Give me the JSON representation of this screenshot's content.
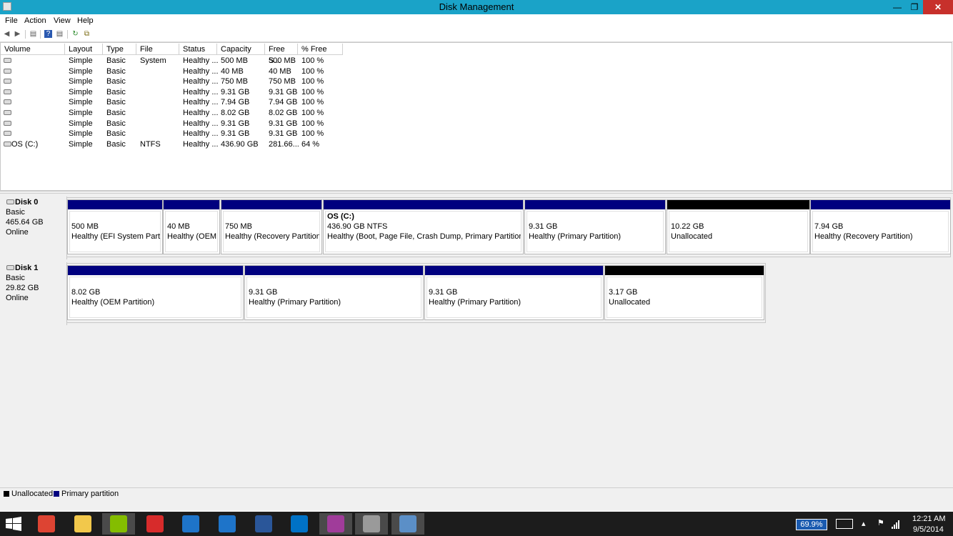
{
  "window": {
    "title": "Disk Management",
    "min_label": "—",
    "max_label": "❐",
    "close_label": "✕"
  },
  "menu": [
    "File",
    "Action",
    "View",
    "Help"
  ],
  "toolbar": {
    "back": "◀",
    "forward": "▶",
    "props": "▤",
    "help": "?",
    "list": "▤",
    "refresh": "↻",
    "rescan": "⧉"
  },
  "columns": [
    "Volume",
    "Layout",
    "Type",
    "File System",
    "Status",
    "Capacity",
    "Free S...",
    "% Free"
  ],
  "volumes": [
    {
      "volume": "",
      "layout": "Simple",
      "type": "Basic",
      "fs": "",
      "status": "Healthy ...",
      "capacity": "500 MB",
      "free": "500 MB",
      "pct": "100 %"
    },
    {
      "volume": "",
      "layout": "Simple",
      "type": "Basic",
      "fs": "",
      "status": "Healthy ...",
      "capacity": "40 MB",
      "free": "40 MB",
      "pct": "100 %"
    },
    {
      "volume": "",
      "layout": "Simple",
      "type": "Basic",
      "fs": "",
      "status": "Healthy ...",
      "capacity": "750 MB",
      "free": "750 MB",
      "pct": "100 %"
    },
    {
      "volume": "",
      "layout": "Simple",
      "type": "Basic",
      "fs": "",
      "status": "Healthy ...",
      "capacity": "9.31 GB",
      "free": "9.31 GB",
      "pct": "100 %"
    },
    {
      "volume": "",
      "layout": "Simple",
      "type": "Basic",
      "fs": "",
      "status": "Healthy ...",
      "capacity": "7.94 GB",
      "free": "7.94 GB",
      "pct": "100 %"
    },
    {
      "volume": "",
      "layout": "Simple",
      "type": "Basic",
      "fs": "",
      "status": "Healthy ...",
      "capacity": "8.02 GB",
      "free": "8.02 GB",
      "pct": "100 %"
    },
    {
      "volume": "",
      "layout": "Simple",
      "type": "Basic",
      "fs": "",
      "status": "Healthy ...",
      "capacity": "9.31 GB",
      "free": "9.31 GB",
      "pct": "100 %"
    },
    {
      "volume": "",
      "layout": "Simple",
      "type": "Basic",
      "fs": "",
      "status": "Healthy ...",
      "capacity": "9.31 GB",
      "free": "9.31 GB",
      "pct": "100 %"
    },
    {
      "volume": "OS (C:)",
      "layout": "Simple",
      "type": "Basic",
      "fs": "NTFS",
      "status": "Healthy ...",
      "capacity": "436.90 GB",
      "free": "281.66...",
      "pct": "64 %"
    }
  ],
  "disks": [
    {
      "name": "Disk 0",
      "kind": "Basic",
      "size": "465.64 GB",
      "state": "Online",
      "partitions": [
        {
          "title": "",
          "size": "500 MB",
          "status": "Healthy (EFI System Partitic",
          "type": "primary"
        },
        {
          "title": "",
          "size": "40 MB",
          "status": "Healthy (OEM F",
          "type": "primary"
        },
        {
          "title": "",
          "size": "750 MB",
          "status": "Healthy (Recovery Partition)",
          "type": "primary"
        },
        {
          "title": "OS  (C:)",
          "size": "436.90 GB NTFS",
          "status": "Healthy (Boot, Page File, Crash Dump, Primary Partition)",
          "type": "primary"
        },
        {
          "title": "",
          "size": "9.31 GB",
          "status": "Healthy (Primary Partition)",
          "type": "primary"
        },
        {
          "title": "",
          "size": "10.22 GB",
          "status": "Unallocated",
          "type": "unallocated"
        },
        {
          "title": "",
          "size": "7.94 GB",
          "status": "Healthy (Recovery Partition)",
          "type": "primary"
        }
      ]
    },
    {
      "name": "Disk 1",
      "kind": "Basic",
      "size": "29.82 GB",
      "state": "Online",
      "partitions": [
        {
          "title": "",
          "size": "8.02 GB",
          "status": "Healthy (OEM Partition)",
          "type": "primary"
        },
        {
          "title": "",
          "size": "9.31 GB",
          "status": "Healthy (Primary Partition)",
          "type": "primary"
        },
        {
          "title": "",
          "size": "9.31 GB",
          "status": "Healthy (Primary Partition)",
          "type": "primary"
        },
        {
          "title": "",
          "size": "3.17 GB",
          "status": "Unallocated",
          "type": "unallocated"
        }
      ]
    }
  ],
  "legend": {
    "unallocated": "Unallocated",
    "primary": "Primary partition"
  },
  "colors": {
    "titlebar": "#1aa3c8",
    "primary": "#00007f",
    "unallocated": "#000000",
    "close": "#c7302b",
    "taskbar": "#1c1c1c"
  },
  "taskbar": {
    "apps": [
      {
        "icon": "chrome-icon",
        "color": "#dd4433",
        "active": false
      },
      {
        "icon": "file-explorer-icon",
        "color": "#f2c84b",
        "active": false
      },
      {
        "icon": "spotify-icon",
        "color": "#84bd00",
        "active": true
      },
      {
        "icon": "kwick-app-icon",
        "color": "#d72b2b",
        "active": false
      },
      {
        "icon": "mail-icon",
        "color": "#1e74c9",
        "active": false
      },
      {
        "icon": "onedrive-icon",
        "color": "#1e74c9",
        "active": false
      },
      {
        "icon": "word-icon",
        "color": "#2a5699",
        "active": false
      },
      {
        "icon": "outlook-icon",
        "color": "#0072c6",
        "active": false
      },
      {
        "icon": "winrar-icon",
        "color": "#a03c9a",
        "active": true
      },
      {
        "icon": "disk-management-icon",
        "color": "#9a9a9a",
        "active": true
      },
      {
        "icon": "network-drive-icon",
        "color": "#5b8fc7",
        "active": true
      }
    ],
    "battery_pct": "69.9%",
    "time": "12:21 AM",
    "date": "9/5/2014"
  }
}
